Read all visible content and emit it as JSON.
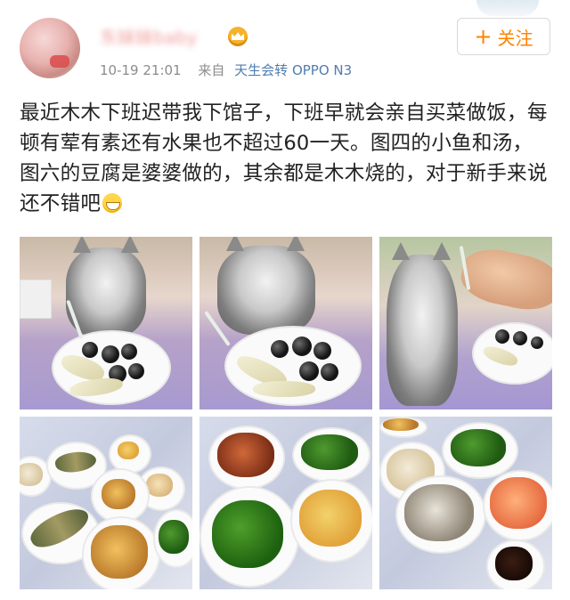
{
  "post": {
    "username": "东妹妹baby",
    "timestamp": "10-19 21:01",
    "from_label": "来自",
    "source": "天生会转 OPPO N3",
    "follow_label": "关注",
    "follow_icon": "plus-icon",
    "content": "最近木木下班迟带我下馆子，下班早就会亲自买菜做饭，每顿有荤有素还有水果也不超过60一天。图四的小鱼和汤，图六的豆腐是婆婆做的，其余都是木木烧的，对于新手来说还不错吧",
    "emoji": "grin-emoji"
  },
  "photos": [
    {
      "name": "cat-with-fruit-1"
    },
    {
      "name": "cat-with-fruit-2"
    },
    {
      "name": "cat-being-fed"
    },
    {
      "name": "dinner-fish-and-soup"
    },
    {
      "name": "dinner-crab-and-vegetables"
    },
    {
      "name": "dinner-tofu-shrimp-clams"
    }
  ],
  "colors": {
    "accent": "#ff8200",
    "link": "#507daf",
    "meta": "#8c8c8c"
  }
}
